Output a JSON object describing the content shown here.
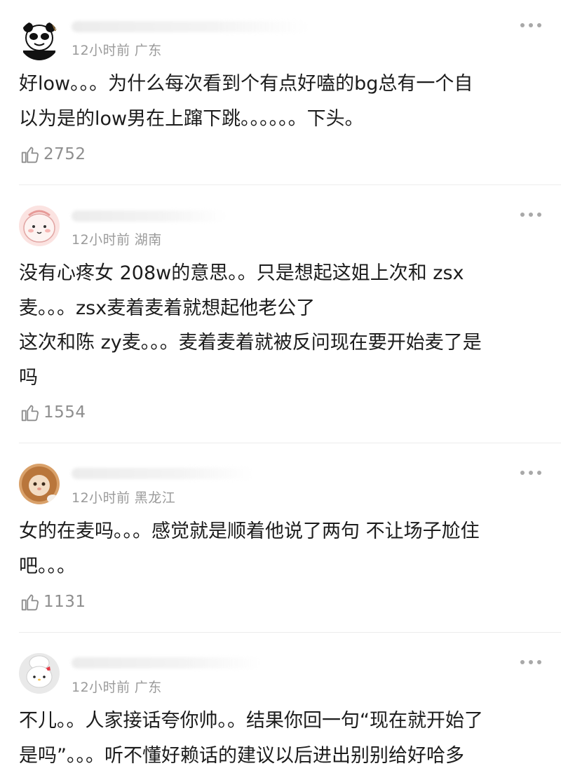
{
  "comments": [
    {
      "time": "12小时前",
      "location": "广东",
      "text": "好low。。。为什么每次看到个有点好嗑的bg总有一个自\n以为是的low男在上蹿下跳。。。。。。下头。",
      "likes": "2752",
      "avatar_icon": "panda-meme-avatar"
    },
    {
      "time": "12小时前",
      "location": "湖南",
      "text": "没有心疼女 208w的意思。。只是想起这姐上次和 zsx\n麦。。。zsx麦着麦着就想起他老公了\n这次和陈 zy麦。。。麦着麦着就被反问现在要开始麦了是\n吗",
      "likes": "1554",
      "avatar_icon": "pink-cartoon-avatar"
    },
    {
      "time": "12小时前",
      "location": "黑龙江",
      "text": "女的在麦吗。。。感觉就是顺着他说了两句 不让场子尬住\n吧。。。",
      "likes": "1131",
      "avatar_icon": "lion-cat-avatar"
    },
    {
      "time": "12小时前",
      "location": "广东",
      "text": "不儿。。人家接话夸你帅。。结果你回一句“现在就开始了\n是吗”。。。听不懂好赖话的建议以后进出别别给好哈多",
      "likes": "",
      "avatar_icon": "hello-kitty-chef-avatar"
    }
  ],
  "colors": {
    "text": "#1c1c1c",
    "meta": "#9a9a9a",
    "like": "#8e8e8e",
    "divider": "#ececec"
  }
}
